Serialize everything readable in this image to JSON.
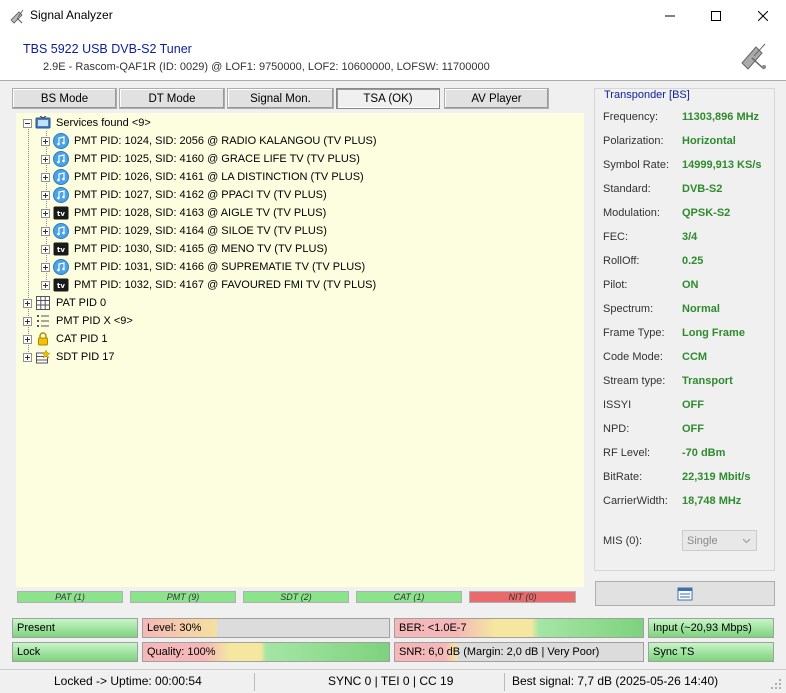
{
  "window": {
    "title": "Signal Analyzer"
  },
  "header": {
    "tuner_name": "TBS 5922 USB DVB-S2 Tuner",
    "tuner_info": "2.9E - Rascom-QAF1R (ID: 0029) @ LOF1: 9750000, LOF2: 10600000, LOFSW: 11700000"
  },
  "tabs": [
    {
      "label": "BS Mode"
    },
    {
      "label": "DT Mode"
    },
    {
      "label": "Signal Mon."
    },
    {
      "label": "TSA (OK)",
      "active": true
    },
    {
      "label": "AV Player"
    }
  ],
  "tree": {
    "root": "Services found <9>",
    "services": [
      {
        "label": "PMT PID: 1024, SID: 2056 @ RADIO KALANGOU (TV PLUS)",
        "icon": "music-icon"
      },
      {
        "label": "PMT PID: 1025, SID: 4160 @ GRACE LIFE TV (TV PLUS)",
        "icon": "music-icon"
      },
      {
        "label": "PMT PID: 1026, SID: 4161 @ LA DISTINCTION (TV PLUS)",
        "icon": "music-icon"
      },
      {
        "label": "PMT PID: 1027, SID: 4162 @ PPACI TV (TV PLUS)",
        "icon": "music-icon"
      },
      {
        "label": "PMT PID: 1028, SID: 4163 @ AIGLE TV (TV PLUS)",
        "icon": "tv-icon"
      },
      {
        "label": "PMT PID: 1029, SID: 4164 @ SILOE TV (TV PLUS)",
        "icon": "music-icon"
      },
      {
        "label": "PMT PID: 1030, SID: 4165 @ MENO TV (TV PLUS)",
        "icon": "tv-icon"
      },
      {
        "label": "PMT PID: 1031, SID: 4166 @ SUPREMATIE TV (TV PLUS)",
        "icon": "music-icon"
      },
      {
        "label": "PMT PID: 1032, SID: 4167 @ FAVOURED FMI TV (TV PLUS)",
        "icon": "tv-icon"
      }
    ],
    "tables": [
      {
        "label": "PAT PID 0",
        "icon": "grid-icon"
      },
      {
        "label": "PMT PID X <9>",
        "icon": "list-icon"
      },
      {
        "label": "CAT PID 1",
        "icon": "lock-icon"
      },
      {
        "label": "SDT PID 17",
        "icon": "star-table-icon"
      }
    ]
  },
  "table_badges": [
    {
      "label": "PAT (1)",
      "status": "ok"
    },
    {
      "label": "PMT (9)",
      "status": "ok"
    },
    {
      "label": "SDT (2)",
      "status": "ok"
    },
    {
      "label": "CAT (1)",
      "status": "ok"
    },
    {
      "label": "NIT (0)",
      "status": "bad"
    }
  ],
  "transponder": {
    "title": "Transponder [BS]",
    "rows": [
      {
        "label": "Frequency:",
        "value": "11303,896 MHz"
      },
      {
        "label": "Polarization:",
        "value": "Horizontal"
      },
      {
        "label": "Symbol Rate:",
        "value": "14999,913 KS/s"
      },
      {
        "label": "Standard:",
        "value": "DVB-S2"
      },
      {
        "label": "Modulation:",
        "value": "QPSK-S2"
      },
      {
        "label": "FEC:",
        "value": "3/4"
      },
      {
        "label": "RollOff:",
        "value": "0.25"
      },
      {
        "label": "Pilot:",
        "value": "ON"
      },
      {
        "label": "Spectrum:",
        "value": "Normal"
      },
      {
        "label": "Frame Type:",
        "value": "Long Frame"
      },
      {
        "label": "Code Mode:",
        "value": "CCM"
      },
      {
        "label": "Stream type:",
        "value": "Transport"
      },
      {
        "label": "ISSYI",
        "value": "OFF"
      },
      {
        "label": "NPD:",
        "value": "OFF"
      },
      {
        "label": "RF Level:",
        "value": "-70 dBm"
      },
      {
        "label": "BitRate:",
        "value": "22,319 Mbit/s"
      },
      {
        "label": "CarrierWidth:",
        "value": "18,748 MHz"
      }
    ],
    "mis_label": "MIS (0):",
    "mis_value": "Single"
  },
  "status_bars": {
    "present": {
      "label": "Present",
      "fill": 1.0
    },
    "level": {
      "label": "Level: 30%",
      "fill": 0.3
    },
    "ber": {
      "label": "BER: <1.0E-7",
      "fill": 1.0
    },
    "input": {
      "label": "Input (~20,93 Mbps)",
      "fill": 1.0
    },
    "lock": {
      "label": "Lock",
      "fill": 1.0
    },
    "quality": {
      "label": "Quality: 100%",
      "fill": 1.0
    },
    "snr": {
      "label": "SNR: 6,0 dB (Margin: 2,0 dB | Very Poor)",
      "fill": 0.25
    },
    "sync": {
      "label": "Sync TS",
      "fill": 1.0
    }
  },
  "statusbar": {
    "uptime": "Locked -> Uptime: 00:00:54",
    "counters": "SYNC 0 | TEI 0 | CC 19",
    "best_signal": "Best signal: 7,7 dB (2025-05-26 14:40)"
  }
}
